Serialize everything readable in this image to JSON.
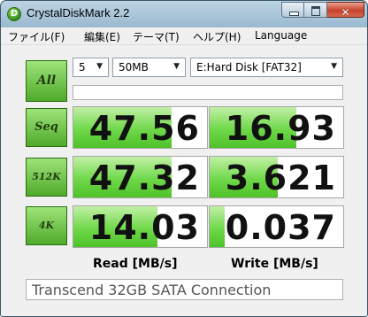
{
  "window": {
    "title": "CrystalDiskMark 2.2",
    "icon_letter": "D",
    "close_glyph": "✕"
  },
  "menu": [
    "ファイル(F)",
    "編集(E)",
    "テーマ(T)",
    "ヘルプ(H)",
    "Language"
  ],
  "controls": {
    "all_label": "All",
    "test_count": "5",
    "test_size": "50MB",
    "drive": "E:Hard Disk [FAT32]",
    "dropdown_glyph": "▼"
  },
  "tests": [
    {
      "label": "Seq",
      "read": "47.56",
      "write": "16.93",
      "read_value": 47.56,
      "write_value": 16.93
    },
    {
      "label": "512K",
      "read": "47.32",
      "write": "3.621",
      "read_value": 47.32,
      "write_value": 3.621
    },
    {
      "label": "4K",
      "read": "14.03",
      "write": "0.037",
      "read_value": 14.03,
      "write_value": 0.037
    }
  ],
  "columns": {
    "read": "Read [MB/s]",
    "write": "Write [MB/s]"
  },
  "comment": "Transcend 32GB SATA Connection",
  "colors": {
    "accent_green": "#4ec229",
    "button_green": "#6cc447"
  }
}
